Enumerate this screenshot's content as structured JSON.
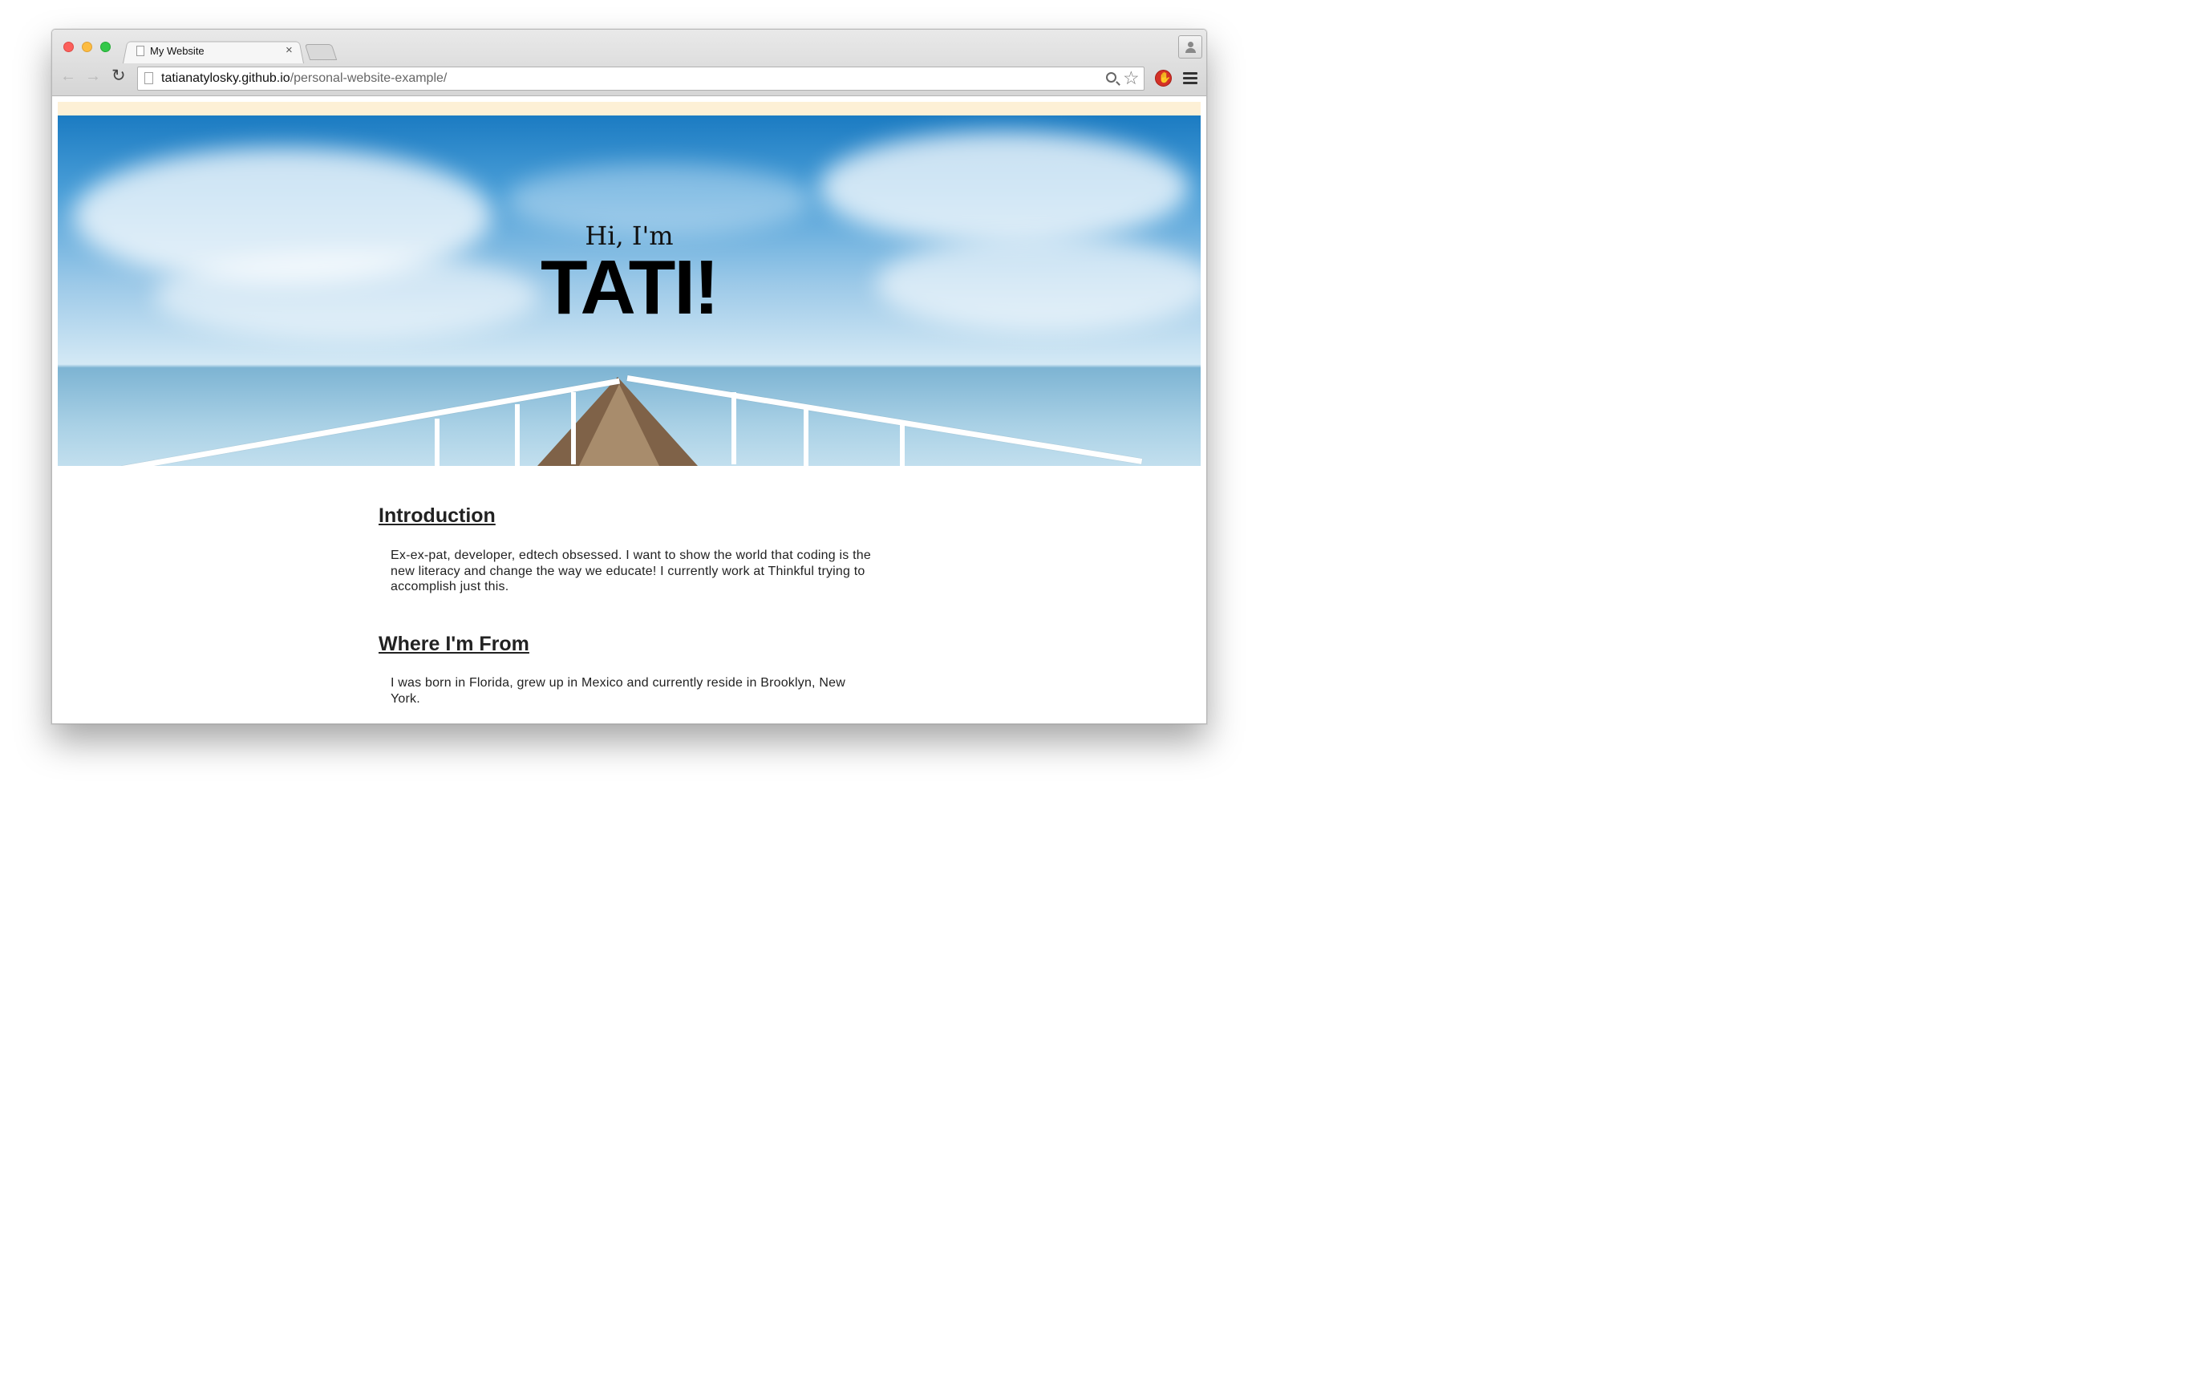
{
  "browser": {
    "tab": {
      "title": "My Website",
      "close_glyph": "×"
    },
    "nav": {
      "back_icon": "←",
      "forward_icon": "→",
      "reload_icon": "↻"
    },
    "address_bar": {
      "host": "tatianatylosky.github.io",
      "path": "/personal-website-example/"
    },
    "icons": [
      "page-icon",
      "zoom-icon",
      "bookmark-star-icon",
      "stop-extension-icon",
      "menu-icon",
      "profile-icon"
    ]
  },
  "page": {
    "hero": {
      "greeting": "Hi, I'm",
      "name": "TATI!"
    },
    "sections": [
      {
        "title": "Introduction",
        "body": "Ex-ex-pat, developer, edtech obsessed. I want to show the world that coding is the new literacy and change the way we educate! I currently work at Thinkful trying to accomplish just this."
      },
      {
        "title": "Where I'm From",
        "body": "I was born in Florida, grew up in Mexico and currently reside in Brooklyn, New York."
      }
    ]
  },
  "colors": {
    "top_strip": "#fdf0d6",
    "sky_top": "#1b7bc2",
    "sea": "#7db4d3",
    "text": "#222222"
  }
}
